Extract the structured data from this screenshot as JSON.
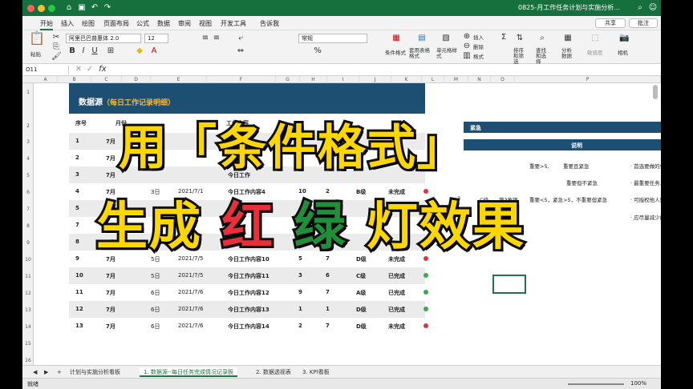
{
  "window": {
    "title": "0825-月工作任务计划与实施分析..."
  },
  "menu": {
    "tabs": [
      "开始",
      "插入",
      "绘图",
      "页面布局",
      "公式",
      "数据",
      "审阅",
      "视图",
      "开发工具",
      "告诉我"
    ],
    "share": "共享",
    "comment": "批注"
  },
  "ribbon": {
    "paste": "粘贴",
    "font_name": "阿里巴巴普惠体 2.0",
    "font_size": "12",
    "number_format": "常规",
    "groups": [
      "条件格式",
      "套用表格格式",
      "单元格样式",
      "插入",
      "删除",
      "格式",
      "排序和筛选",
      "查找和选择",
      "分析数据",
      "敏感度",
      "相机"
    ]
  },
  "formula": {
    "namebox": "O11"
  },
  "columns": [
    "A",
    "B",
    "C",
    "D",
    "E",
    "F",
    "G",
    "H",
    "I",
    "J",
    "K",
    "L",
    "M",
    "N",
    "O",
    "P"
  ],
  "rows": [
    "1",
    "2",
    "3",
    "4",
    "5",
    "6",
    "7",
    "8",
    "9",
    "10",
    "11",
    "12",
    "13",
    "14",
    "15",
    "16",
    "17"
  ],
  "banner": {
    "title": "数据源",
    "subtitle": "（每日工作记录明细）"
  },
  "headers": {
    "seq": "序号",
    "month": "月份",
    "content": "工作内容",
    "urgency": "紧急",
    "importance": "重要"
  },
  "table": [
    {
      "seq": "1",
      "month": "7月",
      "day": "",
      "date": "",
      "content": "今日工作",
      "g": "",
      "h": "",
      "level": "",
      "status": "",
      "dot": ""
    },
    {
      "seq": "2",
      "month": "7月",
      "day": "",
      "date": "",
      "content": "今日工作",
      "g": "",
      "h": "",
      "level": "",
      "status": "",
      "dot": ""
    },
    {
      "seq": "3",
      "month": "7月",
      "day": "",
      "date": "",
      "content": "今日工作",
      "g": "",
      "h": "",
      "level": "",
      "status": "",
      "dot": ""
    },
    {
      "seq": "4",
      "month": "7月",
      "day": "3日",
      "date": "2021/7/1",
      "content": "今日工作内容4",
      "g": "10",
      "h": "2",
      "level": "B级",
      "status": "未完成",
      "dot": "red"
    },
    {
      "seq": "5",
      "month": "7月",
      "day": "",
      "date": "",
      "content": "",
      "g": "",
      "h": "",
      "level": "",
      "status": "",
      "dot": ""
    },
    {
      "seq": "7",
      "month": "7月",
      "day": "",
      "date": "",
      "content": "",
      "g": "",
      "h": "",
      "level": "",
      "status": "",
      "dot": "green"
    },
    {
      "seq": "8",
      "month": "7月",
      "day": "",
      "date": "",
      "content": "",
      "g": "",
      "h": "",
      "level": "",
      "status": "",
      "dot": "green"
    },
    {
      "seq": "9",
      "month": "7月",
      "day": "5日",
      "date": "2021/7/5",
      "content": "今日工作内容10",
      "g": "5",
      "h": "7",
      "level": "D级",
      "status": "未完成",
      "dot": "red"
    },
    {
      "seq": "10",
      "month": "7月",
      "day": "5日",
      "date": "2021/7/5",
      "content": "今日工作内容11",
      "g": "3",
      "h": "6",
      "level": "C级",
      "status": "已完成",
      "dot": "green"
    },
    {
      "seq": "11",
      "month": "7月",
      "day": "6日",
      "date": "2021/7/6",
      "content": "今日工作内容12",
      "g": "9",
      "h": "7",
      "level": "A级",
      "status": "已完成",
      "dot": "green"
    },
    {
      "seq": "12",
      "month": "7月",
      "day": "6日",
      "date": "2021/7/6",
      "content": "今日工作内容13",
      "g": "1",
      "h": "1",
      "level": "D级",
      "status": "已完成",
      "dot": "green"
    },
    {
      "seq": "13",
      "month": "7月",
      "day": "6日",
      "date": "2021/7/6",
      "content": "今日工作内容14",
      "g": "2",
      "h": "7",
      "level": "D级",
      "status": "未完成",
      "dot": "red"
    }
  ],
  "right_panel": {
    "head": "紧急",
    "col_desc": "说明",
    "r1": "重要>5,",
    "r1b": "重要且紧急",
    "r2": "重要但不紧急",
    "r3a": "3",
    "r3b": "C级",
    "r3c": "第3象限",
    "r3d": "重要<5，紧急>5，不重要但紧急",
    "n1": "· 首选要做的任务，尽",
    "n2": "· 最重要任务，需着重",
    "n3": "· 可授权他人协助完成",
    "n4": "· 应尽量减少的工作"
  },
  "sheets": [
    "计划与实施分析看板",
    "1. 数据源--每日任务完成情况记录板",
    "2. 数据透视表",
    "3. KPI看板"
  ],
  "status": {
    "left": "就绪",
    "zoom": "100%"
  },
  "overlay": {
    "line1": "用「条件格式」",
    "line2_a": "生成",
    "line2_b": "红",
    "line2_c": "绿",
    "line2_d": "灯效果"
  },
  "colors": {
    "accent": "#217346",
    "banner": "#1c4f72",
    "red_dot": "#e0343c",
    "green_dot": "#3ea84b",
    "overlay_yellow": "#ffd700",
    "overlay_red": "#e8303a",
    "overlay_green": "#1f8f3a"
  }
}
